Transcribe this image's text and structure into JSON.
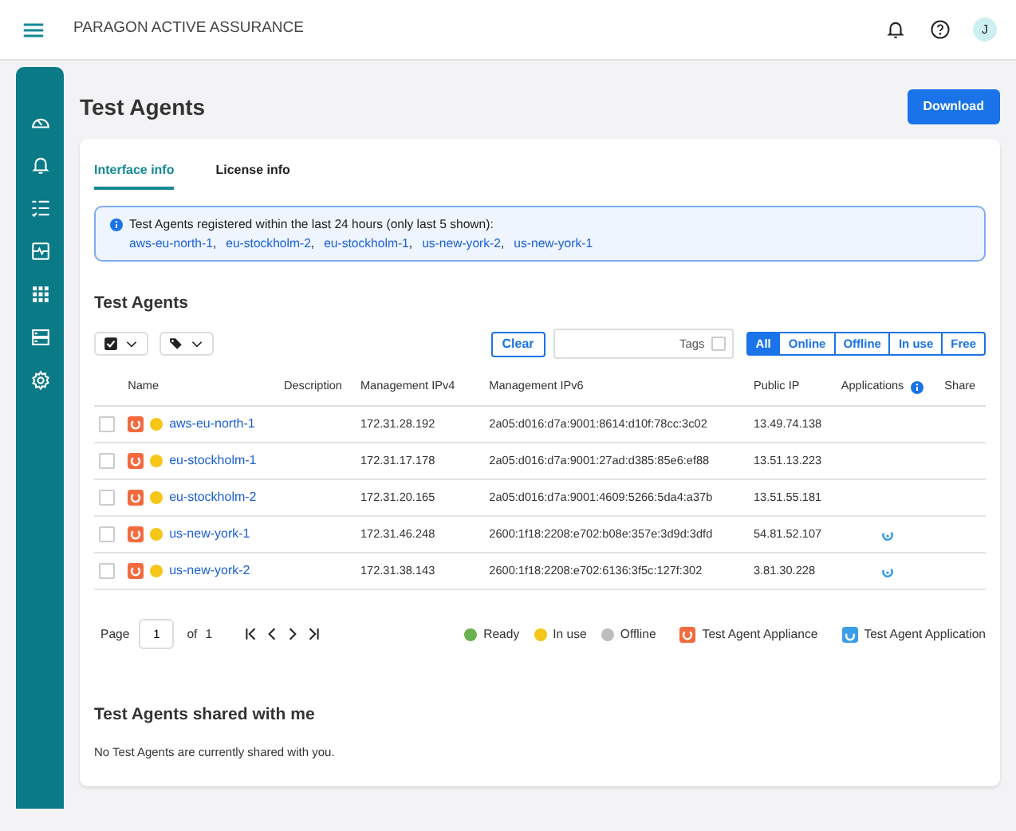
{
  "app": {
    "title": "PARAGON ACTIVE ASSURANCE",
    "avatar": "J"
  },
  "page": {
    "title": "Test Agents",
    "download": "Download"
  },
  "tabs": [
    {
      "label": "Interface info",
      "selected": true
    },
    {
      "label": "License info",
      "selected": false
    }
  ],
  "notice": {
    "text": "Test Agents registered within the last 24 hours (only last 5 shown):",
    "links": [
      "aws-eu-north-1",
      "eu-stockholm-2",
      "eu-stockholm-1",
      "us-new-york-2",
      "us-new-york-1"
    ],
    "separators": [
      ",",
      ",",
      ",",
      ","
    ]
  },
  "agents": {
    "title": "Test Agents",
    "clear": "Clear",
    "tags_label": "Tags",
    "tags_checked": false,
    "status_filters": [
      {
        "label": "All",
        "selected": true
      },
      {
        "label": "Online",
        "selected": false
      },
      {
        "label": "Offline",
        "selected": false
      },
      {
        "label": "In use",
        "selected": false
      },
      {
        "label": "Free",
        "selected": false
      }
    ],
    "columns": [
      "Name",
      "Description",
      "Management IPv4",
      "Management IPv6",
      "Public IP",
      "Applications",
      "Share"
    ],
    "rows": [
      {
        "checked": false,
        "color": "#f5c518",
        "name": "aws-eu-north-1",
        "ipv4": "172.31.28.192",
        "ipv6": "2a05:d016:d7a:9001:8614:d10f:78cc:3c02",
        "public_ip": "13.49.74.138",
        "application": false
      },
      {
        "checked": false,
        "color": "#f5c518",
        "name": "eu-stockholm-1",
        "ipv4": "172.31.17.178",
        "ipv6": "2a05:d016:d7a:9001:27ad:d385:85e6:ef88",
        "public_ip": "13.51.13.223",
        "application": false
      },
      {
        "checked": false,
        "color": "#f5c518",
        "name": "eu-stockholm-2",
        "ipv4": "172.31.20.165",
        "ipv6": "2a05:d016:d7a:9001:4609:5266:5da4:a37b",
        "public_ip": "13.51.55.181",
        "application": false
      },
      {
        "checked": false,
        "color": "#f5c518",
        "name": "us-new-york-1",
        "ipv4": "172.31.46.248",
        "ipv6": "2600:1f18:2208:e702:b08e:357e:3d9d:3dfd",
        "public_ip": "54.81.52.107",
        "application": true
      },
      {
        "checked": false,
        "color": "#f5c518",
        "name": "us-new-york-2",
        "ipv4": "172.31.38.143",
        "ipv6": "2600:1f18:2208:e702:6136:3f5c:127f:302",
        "public_ip": "3.81.30.228",
        "application": true
      }
    ],
    "pagination": {
      "page_label": "Page",
      "page": "1",
      "of_label": "of",
      "total": "1"
    },
    "legend": [
      {
        "kind": "dot",
        "label": "Ready",
        "color": "#6ab04c"
      },
      {
        "kind": "dot",
        "label": "In use",
        "color": "#f5c518"
      },
      {
        "kind": "dot",
        "label": "Offline",
        "color": "#bdbdbd"
      },
      {
        "kind": "appliance",
        "label": "Test Agent Appliance",
        "color": "#f26a3d"
      },
      {
        "kind": "application",
        "label": "Test Agent Application",
        "color": "#3b9ee8"
      }
    ]
  },
  "shared": {
    "title": "Test Agents shared with me",
    "empty": "No Test Agents are currently shared with you."
  }
}
